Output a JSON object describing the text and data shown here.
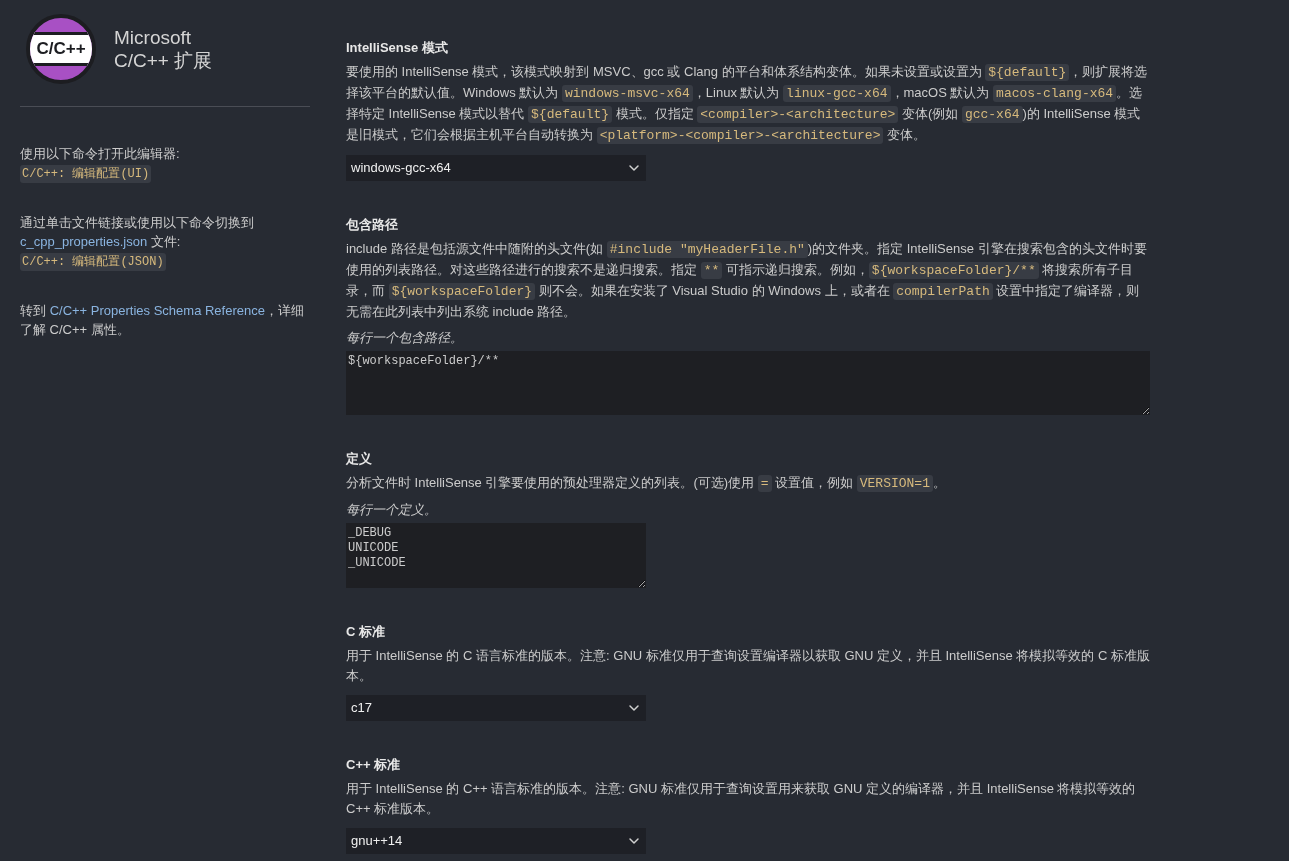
{
  "header": {
    "logo_text": "C/C++",
    "title_lines": [
      "Microsoft",
      "C/C++ 扩展"
    ]
  },
  "sidebar": {
    "notes": [
      {
        "segments": [
          {
            "kind": "text",
            "text": "使用以下命令打开此编辑器:"
          }
        ],
        "command": "C/C++: 编辑配置(UI)"
      },
      {
        "segments": [
          {
            "kind": "text",
            "text": "通过单击文件链接或使用以下命令切换到 "
          },
          {
            "kind": "link",
            "text": "c_cpp_properties.json"
          },
          {
            "kind": "text",
            "text": " 文件:"
          }
        ],
        "command": "C/C++: 编辑配置(JSON)"
      },
      {
        "segments": [
          {
            "kind": "text",
            "text": "转到 "
          },
          {
            "kind": "link",
            "text": "C/C++ Properties Schema Reference"
          },
          {
            "kind": "text",
            "text": "，详细了解 C/C++ 属性。"
          }
        ]
      }
    ]
  },
  "settings": [
    {
      "kind": "select",
      "title": "IntelliSense 模式",
      "description": [
        {
          "kind": "text",
          "text": "要使用的 IntelliSense 模式，该模式映射到 MSVC、gcc 或 Clang 的平台和体系结构变体。如果未设置或设置为 "
        },
        {
          "kind": "code",
          "text": "${default}"
        },
        {
          "kind": "text",
          "text": "，则扩展将选择该平台的默认值。Windows 默认为 "
        },
        {
          "kind": "code",
          "text": "windows-msvc-x64"
        },
        {
          "kind": "text",
          "text": "，Linux 默认为 "
        },
        {
          "kind": "code",
          "text": "linux-gcc-x64"
        },
        {
          "kind": "text",
          "text": "，macOS 默认为 "
        },
        {
          "kind": "code",
          "text": "macos-clang-x64"
        },
        {
          "kind": "text",
          "text": "。选择特定 IntelliSense 模式以替代 "
        },
        {
          "kind": "code",
          "text": "${default}"
        },
        {
          "kind": "text",
          "text": " 模式。仅指定 "
        },
        {
          "kind": "code",
          "text": "<compiler>-<architecture>"
        },
        {
          "kind": "text",
          "text": " 变体(例如 "
        },
        {
          "kind": "code",
          "text": "gcc-x64"
        },
        {
          "kind": "text",
          "text": ")的 IntelliSense 模式是旧模式，它们会根据主机平台自动转换为 "
        },
        {
          "kind": "code",
          "text": "<platform>-<compiler>-<architecture>"
        },
        {
          "kind": "text",
          "text": " 变体。"
        }
      ],
      "value": "windows-gcc-x64"
    },
    {
      "kind": "pathlist",
      "title": "包含路径",
      "description": [
        {
          "kind": "text",
          "text": "include 路径是包括源文件中随附的头文件(如 "
        },
        {
          "kind": "code",
          "text": "#include \"myHeaderFile.h\""
        },
        {
          "kind": "text",
          "text": ")的文件夹。指定 IntelliSense 引擎在搜索包含的头文件时要使用的列表路径。对这些路径进行的搜索不是递归搜索。指定 "
        },
        {
          "kind": "code",
          "text": "**"
        },
        {
          "kind": "text",
          "text": " 可指示递归搜索。例如，"
        },
        {
          "kind": "code",
          "text": "${workspaceFolder}/**"
        },
        {
          "kind": "text",
          "text": " 将搜索所有子目录，而 "
        },
        {
          "kind": "code",
          "text": "${workspaceFolder}"
        },
        {
          "kind": "text",
          "text": " 则不会。如果在安装了 Visual Studio 的 Windows 上，或者在 "
        },
        {
          "kind": "code",
          "text": "compilerPath"
        },
        {
          "kind": "text",
          "text": " 设置中指定了编译器，则无需在此列表中列出系统 include 路径。"
        }
      ],
      "hint": "每行一个包含路径。",
      "lines": [
        "${workspaceFolder}/**"
      ]
    },
    {
      "kind": "deflist",
      "title": "定义",
      "description": [
        {
          "kind": "text",
          "text": "分析文件时 IntelliSense 引擎要使用的预处理器定义的列表。(可选)使用 "
        },
        {
          "kind": "code",
          "text": "="
        },
        {
          "kind": "text",
          "text": " 设置值，例如 "
        },
        {
          "kind": "code",
          "text": "VERSION=1"
        },
        {
          "kind": "text",
          "text": "。"
        }
      ],
      "hint": "每行一个定义。",
      "lines": [
        "_DEBUG",
        "UNICODE",
        "_UNICODE"
      ]
    },
    {
      "kind": "select",
      "title": "C 标准",
      "description": [
        {
          "kind": "text",
          "text": "用于 IntelliSense 的 C 语言标准的版本。注意: GNU 标准仅用于查询设置编译器以获取 GNU 定义，并且 IntelliSense 将模拟等效的 C 标准版本。"
        }
      ],
      "value": "c17"
    },
    {
      "kind": "select",
      "title": "C++ 标准",
      "description": [
        {
          "kind": "text",
          "text": "用于 IntelliSense 的 C++ 语言标准的版本。注意: GNU 标准仅用于查询设置用来获取 GNU 定义的编译器，并且 IntelliSense 将模拟等效的 C++ 标准版本。"
        }
      ],
      "value": "gnu++14"
    }
  ]
}
